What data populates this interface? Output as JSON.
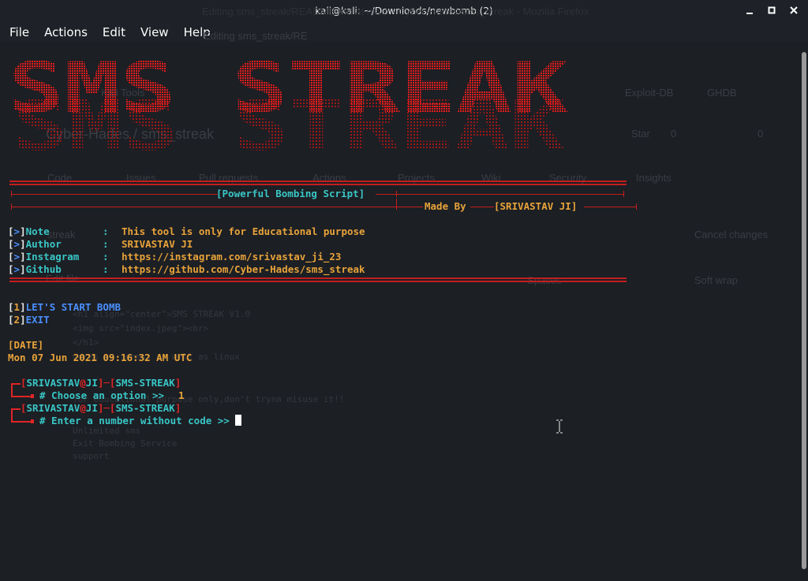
{
  "window": {
    "title": "kali@kali: ~/Downloads/newbomb (2)",
    "buttons": [
      "minimize",
      "maximize",
      "close"
    ]
  },
  "menu": [
    "File",
    "Actions",
    "Edit",
    "View",
    "Help"
  ],
  "background_ghost": {
    "window_title": "Editing sms_streak/README.md at main · Cyber-Hades/sms_streak - Mozilla Firefox",
    "tab": "Editing sms_streak/RE",
    "bookmarks": [
      "Kali Tools",
      "Exploit-DB",
      "GHDB"
    ],
    "repo": "Cyber-Hades / sms_streak",
    "star": "Star",
    "star_count": "0",
    "fork_count": "0",
    "repo_tabs": [
      "Code",
      "Issues",
      "Pull requests",
      "Actions",
      "Projects",
      "Wiki",
      "Security",
      "Insights"
    ],
    "branch": "streak",
    "cancel": "Cancel changes",
    "edit_file": "Edit file",
    "spaces": "Spaces",
    "soft_wrap": "Soft wrap",
    "code_lines": [
      "<h1 align=\"center\">SMS STREAK V1.0",
      "<img src=\"index.jpeg\"><br>",
      "</h1>",
      "works on termux as well as linux",
      "for educational purpose only,don't tryna misuse it!!",
      "Unlimited sms",
      "Exit Bombing Service",
      "support"
    ]
  },
  "banner": {
    "text": "SMS STREAK",
    "color": "#e51c1c"
  },
  "terminal": {
    "subtitle": "[Powerful Bombing Script]",
    "made_by_label": "Made By",
    "made_by_name": "[SRIVASTAV JI]",
    "info": [
      {
        "key": "Note",
        "value": "This tool is only for Educational purpose"
      },
      {
        "key": "Author",
        "value": "SRIVASTAV JI"
      },
      {
        "key": "Instagram",
        "value": "https://instagram.com/srivastav_ji_23"
      },
      {
        "key": "Github",
        "value": "https://github.com/Cyber-Hades/sms_streak"
      }
    ],
    "options": [
      {
        "num": "1",
        "label": "LET'S START BOMB"
      },
      {
        "num": "2",
        "label": "EXIT"
      }
    ],
    "date_label": "[DATE]",
    "date_value": "Mon 07 Jun 2021 09:16:32 AM UTC",
    "prompts": [
      {
        "user": "SRIVASTAV",
        "host": "JI",
        "tool": "SMS-STREAK",
        "question": "# Choose an option >>",
        "answer": "1"
      },
      {
        "user": "SRIVASTAV",
        "host": "JI",
        "tool": "SMS-STREAK",
        "question": "# Enter a number without code >>",
        "answer": ""
      }
    ]
  },
  "colors": {
    "background": "#1c1f24",
    "red": "#e02525",
    "cyan": "#39c6c6",
    "yellow": "#e8a33a",
    "blue": "#4a8fff"
  }
}
